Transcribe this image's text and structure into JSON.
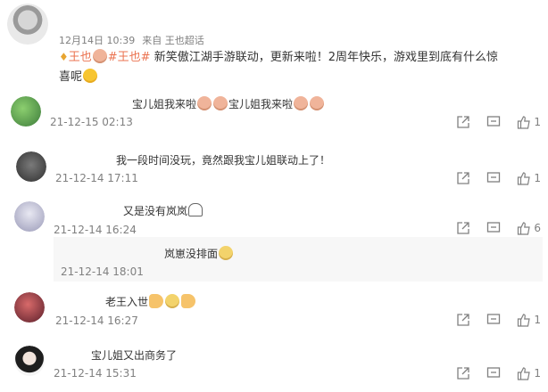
{
  "post": {
    "meta": {
      "date": "12月14日 10:39",
      "source_prefix": "来自",
      "source": "王也超话"
    },
    "tag1": "王也",
    "tag2": "#王也#",
    "text": "新笑傲江湖手游联动，更新来啦！2周年快乐，游戏里到底有什么惊",
    "text2": "喜呢"
  },
  "comments": [
    {
      "text": "宝儿姐我来啦",
      "text2": "宝儿姐我来啦",
      "time": "21-12-15 02:13",
      "likes": "1"
    },
    {
      "text": "我一段时间没玩，竟然跟我宝儿姐联动上了！",
      "time": "21-12-14 17:11",
      "likes": "1"
    },
    {
      "text": "又是没有岚岚",
      "time": "21-12-14 16:24",
      "likes": "6"
    },
    {
      "text": "岚崽没排面",
      "time": "21-12-14 18:01"
    },
    {
      "text": "老王入世",
      "time": "21-12-14 16:27",
      "likes": "1"
    },
    {
      "text": "宝儿姐又出商务了",
      "time": "21-12-14 15:31",
      "likes": "1"
    }
  ],
  "colors": {
    "topic": "#eb7350",
    "meta": "#808080",
    "text": "#333333",
    "reply_bg": "#f7f7f7"
  },
  "icons": [
    "share-icon",
    "comment-icon",
    "like-icon"
  ]
}
